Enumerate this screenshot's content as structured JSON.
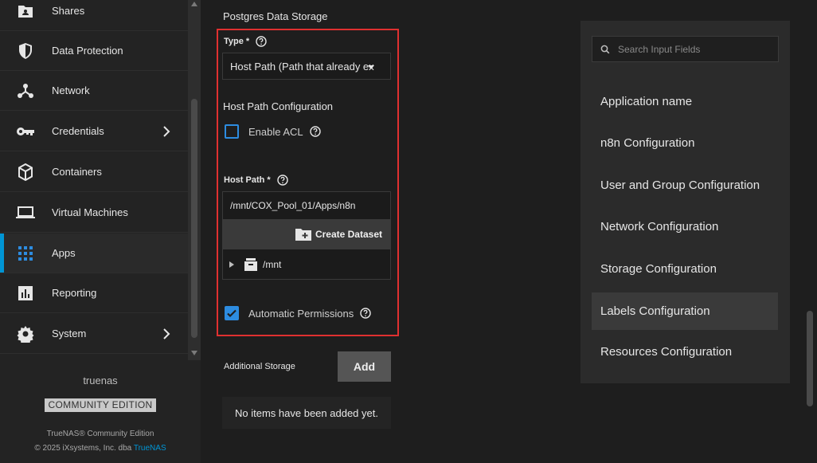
{
  "sidebar": {
    "items": [
      {
        "label": "Shares",
        "icon": "folder-share-icon"
      },
      {
        "label": "Data Protection",
        "icon": "shield-icon"
      },
      {
        "label": "Network",
        "icon": "network-icon"
      },
      {
        "label": "Credentials",
        "icon": "key-icon",
        "has_children": true
      },
      {
        "label": "Containers",
        "icon": "cube-icon"
      },
      {
        "label": "Virtual Machines",
        "icon": "laptop-icon"
      },
      {
        "label": "Apps",
        "icon": "apps-grid-icon",
        "active": true
      },
      {
        "label": "Reporting",
        "icon": "chart-icon"
      },
      {
        "label": "System",
        "icon": "gear-icon",
        "has_children": true
      }
    ],
    "hostname": "truenas",
    "edition_badge": "COMMUNITY EDITION",
    "footer_line1": "TrueNAS® Community Edition",
    "footer_line2_prefix": "© 2025 iXsystems, Inc. dba",
    "footer_link": "TrueNAS"
  },
  "form": {
    "section_title": "Postgres Data Storage",
    "type_label": "Type *",
    "type_value": "Host Path (Path that already ex",
    "host_path_config_title": "Host Path Configuration",
    "enable_acl_label": "Enable ACL",
    "enable_acl_checked": false,
    "host_path_label": "Host Path *",
    "host_path_value": "/mnt/COX_Pool_01/Apps/n8n",
    "create_dataset_label": "Create Dataset",
    "tree_root": "/mnt",
    "auto_permissions_label": "Automatic Permissions",
    "auto_permissions_checked": true,
    "additional_storage_label": "Additional Storage",
    "add_button": "Add",
    "empty_message": "No items have been added yet."
  },
  "toc": {
    "search_placeholder": "Search Input Fields",
    "items": [
      {
        "label": "Application name"
      },
      {
        "label": "n8n Configuration"
      },
      {
        "label": "User and Group Configuration"
      },
      {
        "label": "Network Configuration"
      },
      {
        "label": "Storage Configuration"
      },
      {
        "label": "Labels Configuration",
        "active": true
      },
      {
        "label": "Resources Configuration"
      }
    ]
  },
  "colors": {
    "accent": "#0095d5",
    "checkbox": "#2d8ce0",
    "highlight": "#e03030"
  }
}
